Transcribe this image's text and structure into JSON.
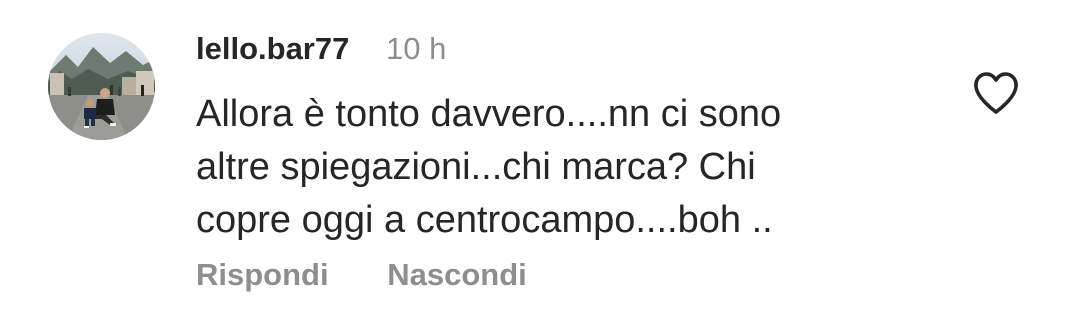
{
  "comment": {
    "username": "lello.bar77",
    "time": "10 h",
    "text_lines": [
      "Allora è tonto davvero....nn ci sono",
      "altre spiegazioni...chi marca? Chi",
      "copre oggi a centrocampo....boh .."
    ],
    "actions": {
      "reply_label": "Rispondi",
      "hide_label": "Nascondi"
    },
    "like_icon": "heart-outline-icon",
    "colors": {
      "text": "#262626",
      "muted": "#8e8e8e",
      "background": "#ffffff"
    }
  }
}
